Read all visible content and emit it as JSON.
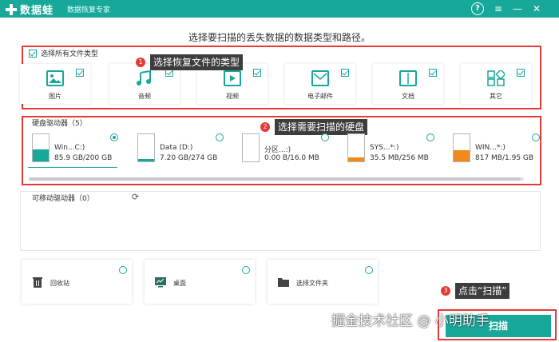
{
  "titlebar": {
    "app_name": "数据蛙",
    "subtitle": "数据恢复专家",
    "help": "?",
    "menu": "≡",
    "minimize": "—",
    "close": "✕"
  },
  "instruction": "选择要扫描的丢失数据的数据类型和路径。",
  "file_types": {
    "select_all_label": "选择所有文件类型",
    "select_all_checked": true,
    "items": [
      {
        "label": "图片",
        "icon": "image-icon",
        "checked": true
      },
      {
        "label": "音频",
        "icon": "music-icon",
        "checked": true
      },
      {
        "label": "视频",
        "icon": "video-icon",
        "checked": true
      },
      {
        "label": "电子邮件",
        "icon": "email-icon",
        "checked": true
      },
      {
        "label": "文档",
        "icon": "document-icon",
        "checked": true
      },
      {
        "label": "其它",
        "icon": "other-icon",
        "checked": true
      }
    ]
  },
  "annotations": {
    "badge1": "1",
    "callout1": "选择恢复文件的类型",
    "badge2": "2",
    "callout2": "选择需要扫描的硬盘",
    "badge3": "3",
    "callout3": "点击“扫描”"
  },
  "hard_drives": {
    "title": "硬盘驱动器（5）",
    "drives": [
      {
        "name": "Win...C:)",
        "size": "85.9 GB/200 GB",
        "fill_fraction": 0.43,
        "fill_color": "#17a89a",
        "selected": true
      },
      {
        "name": "Data (D:)",
        "size": "7.20 GB/274 GB",
        "fill_fraction": 0.03,
        "fill_color": "#17a89a",
        "selected": false
      },
      {
        "name": "分区...:)",
        "size": "0.00  B/16.0 MB",
        "fill_fraction": 0.0,
        "fill_color": "#f08a1c",
        "selected": false
      },
      {
        "name": "SYS...*:)",
        "size": "35.5 MB/256 MB",
        "fill_fraction": 0.14,
        "fill_color": "#f08a1c",
        "selected": false
      },
      {
        "name": "WIN...*:)",
        "size": "817 MB/1.95 GB",
        "fill_fraction": 0.42,
        "fill_color": "#f08a1c",
        "selected": false
      }
    ]
  },
  "removable": {
    "title": "可移动驱动器（0）",
    "refresh_icon": "refresh-icon"
  },
  "locations": [
    {
      "label": "回收站",
      "icon": "recycle-bin-icon"
    },
    {
      "label": "桌面",
      "icon": "desktop-icon"
    },
    {
      "label": "选择文件夹",
      "icon": "folder-icon"
    }
  ],
  "scan_button": "扫描",
  "watermark": "掘金技术社区 @ 小明助手",
  "colors": {
    "accent": "#17a89a",
    "annotation_red": "#e53935",
    "warning_orange": "#f08a1c"
  }
}
